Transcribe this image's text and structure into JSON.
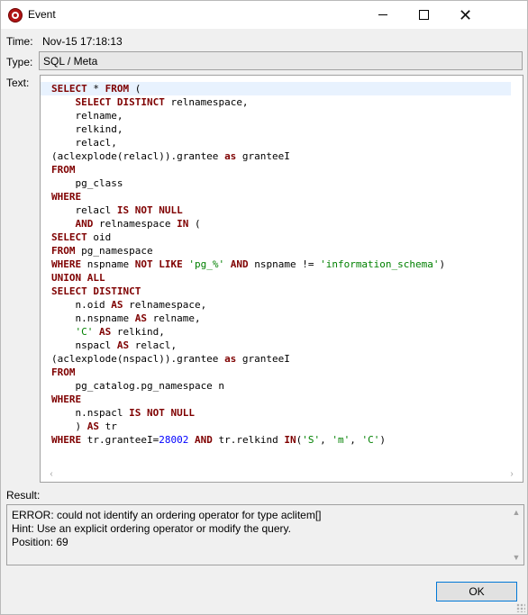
{
  "window": {
    "title": "Event",
    "icon": "app-icon"
  },
  "fields": {
    "time_label": "Time:",
    "time_value": "Nov-15 17:18:13",
    "type_label": "Type:",
    "type_value": "SQL / Meta",
    "text_label": "Text:",
    "result_label": "Result:"
  },
  "sql": {
    "lines": [
      [
        {
          "t": "SELECT",
          "k": "kw"
        },
        {
          "t": " * "
        },
        {
          "t": "FROM",
          "k": "kw"
        },
        {
          "t": " ("
        }
      ],
      [
        {
          "t": "    "
        },
        {
          "t": "SELECT DISTINCT",
          "k": "kw"
        },
        {
          "t": " relnamespace,"
        }
      ],
      [
        {
          "t": "    relname,"
        }
      ],
      [
        {
          "t": "    relkind,"
        }
      ],
      [
        {
          "t": "    relacl,"
        }
      ],
      [
        {
          "t": "(aclexplode(relacl)).grantee "
        },
        {
          "t": "as",
          "k": "kw"
        },
        {
          "t": " granteeI"
        }
      ],
      [
        {
          "t": "FROM",
          "k": "kw"
        }
      ],
      [
        {
          "t": "    pg_class"
        }
      ],
      [
        {
          "t": "WHERE",
          "k": "kw"
        }
      ],
      [
        {
          "t": "    relacl "
        },
        {
          "t": "IS NOT NULL",
          "k": "kw"
        }
      ],
      [
        {
          "t": "    "
        },
        {
          "t": "AND",
          "k": "kw"
        },
        {
          "t": " relnamespace "
        },
        {
          "t": "IN",
          "k": "kw"
        },
        {
          "t": " ("
        }
      ],
      [
        {
          "t": "SELECT",
          "k": "kw"
        },
        {
          "t": " oid"
        }
      ],
      [
        {
          "t": "FROM",
          "k": "kw"
        },
        {
          "t": " pg_namespace"
        }
      ],
      [
        {
          "t": "WHERE",
          "k": "kw"
        },
        {
          "t": " nspname "
        },
        {
          "t": "NOT LIKE",
          "k": "kw"
        },
        {
          "t": " "
        },
        {
          "t": "'pg_%'",
          "k": "str"
        },
        {
          "t": " "
        },
        {
          "t": "AND",
          "k": "kw"
        },
        {
          "t": " nspname != "
        },
        {
          "t": "'information_schema'",
          "k": "str"
        },
        {
          "t": ")"
        }
      ],
      [
        {
          "t": "UNION ALL",
          "k": "kw"
        }
      ],
      [
        {
          "t": "SELECT DISTINCT",
          "k": "kw"
        }
      ],
      [
        {
          "t": "    n.oid "
        },
        {
          "t": "AS",
          "k": "kw"
        },
        {
          "t": " relnamespace,"
        }
      ],
      [
        {
          "t": "    n.nspname "
        },
        {
          "t": "AS",
          "k": "kw"
        },
        {
          "t": " relname,"
        }
      ],
      [
        {
          "t": "    "
        },
        {
          "t": "'C'",
          "k": "str"
        },
        {
          "t": " "
        },
        {
          "t": "AS",
          "k": "kw"
        },
        {
          "t": " relkind,"
        }
      ],
      [
        {
          "t": "    nspacl "
        },
        {
          "t": "AS",
          "k": "kw"
        },
        {
          "t": " relacl,"
        }
      ],
      [
        {
          "t": "(aclexplode(nspacl)).grantee "
        },
        {
          "t": "as",
          "k": "kw"
        },
        {
          "t": " granteeI"
        }
      ],
      [
        {
          "t": "FROM",
          "k": "kw"
        }
      ],
      [
        {
          "t": "    pg_catalog.pg_namespace n"
        }
      ],
      [
        {
          "t": "WHERE",
          "k": "kw"
        }
      ],
      [
        {
          "t": "    n.nspacl "
        },
        {
          "t": "IS NOT NULL",
          "k": "kw"
        }
      ],
      [
        {
          "t": "    ) "
        },
        {
          "t": "AS",
          "k": "kw"
        },
        {
          "t": " tr"
        }
      ],
      [
        {
          "t": "WHERE",
          "k": "kw"
        },
        {
          "t": " tr.granteeI="
        },
        {
          "t": "28002",
          "k": "num"
        },
        {
          "t": " "
        },
        {
          "t": "AND",
          "k": "kw"
        },
        {
          "t": " tr.relkind "
        },
        {
          "t": "IN",
          "k": "kw"
        },
        {
          "t": "("
        },
        {
          "t": "'S'",
          "k": "str"
        },
        {
          "t": ", "
        },
        {
          "t": "'m'",
          "k": "str"
        },
        {
          "t": ", "
        },
        {
          "t": "'C'",
          "k": "str"
        },
        {
          "t": ")"
        }
      ]
    ]
  },
  "result": {
    "lines": [
      "ERROR: could not identify an ordering operator for type aclitem[]",
      "  Hint: Use an explicit ordering operator or modify the query.",
      "  Position: 69"
    ]
  },
  "buttons": {
    "ok_label": "OK"
  },
  "colors": {
    "keyword": "#7f0000",
    "string": "#008000",
    "number": "#0000ff",
    "accent": "#0078d7"
  }
}
